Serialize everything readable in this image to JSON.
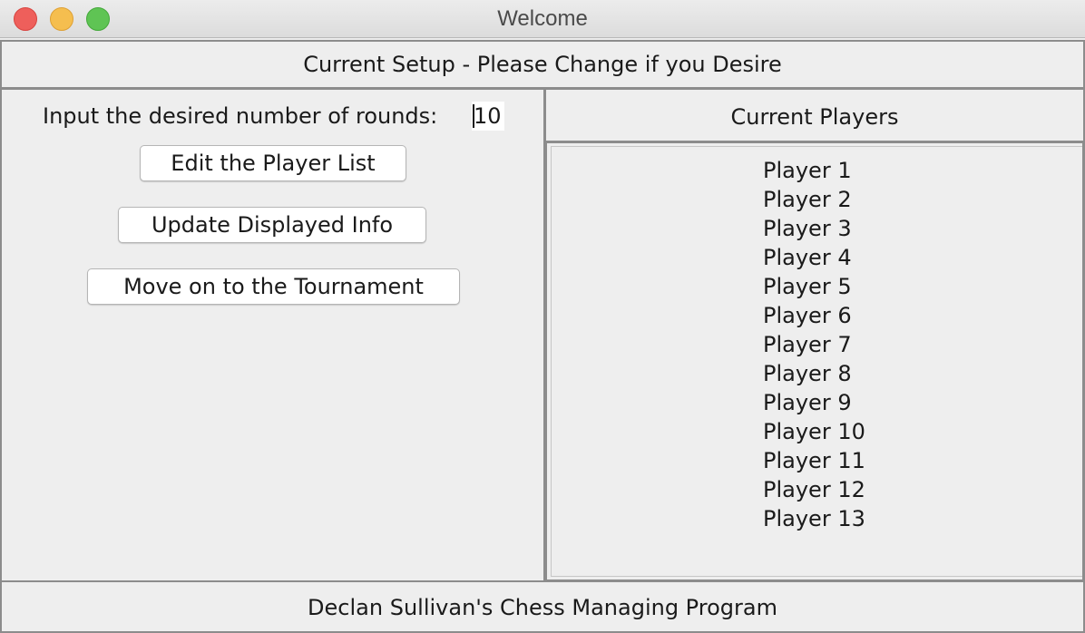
{
  "window": {
    "title": "Welcome"
  },
  "header": {
    "text": "Current Setup - Please Change if you Desire"
  },
  "left_panel": {
    "rounds_label": "Input the desired number of rounds:",
    "rounds_value": "10",
    "buttons": {
      "edit_players": "Edit the Player List",
      "update_info": "Update Displayed Info",
      "move_on": "Move on to the Tournament"
    }
  },
  "right_panel": {
    "title": "Current Players",
    "players": [
      "Player 1",
      "Player 2",
      "Player 3",
      "Player 4",
      "Player 5",
      "Player 6",
      "Player 7",
      "Player 8",
      "Player 9",
      "Player 10",
      "Player 11",
      "Player 12",
      "Player 13"
    ]
  },
  "footer": {
    "text": "Declan Sullivan's Chess Managing Program"
  },
  "colors": {
    "close": "#ee5f5b",
    "minimize": "#f5be4f",
    "maximize": "#5fc454"
  }
}
